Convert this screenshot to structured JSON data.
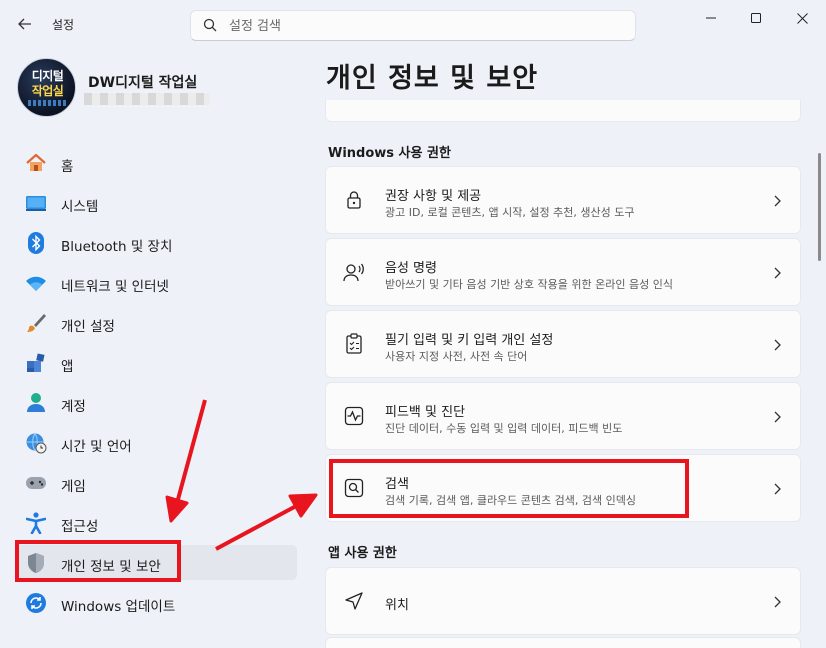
{
  "window": {
    "app_title": "설정",
    "search_placeholder": "설정 검색"
  },
  "profile": {
    "name": "DW디지털 작업실",
    "avatar_text_line1": "디지털",
    "avatar_text_line2": "작업실"
  },
  "sidebar": {
    "items": [
      {
        "label": "홈",
        "icon": "home-icon"
      },
      {
        "label": "시스템",
        "icon": "monitor-icon"
      },
      {
        "label": "Bluetooth 및 장치",
        "icon": "bluetooth-icon"
      },
      {
        "label": "네트워크 및 인터넷",
        "icon": "wifi-icon"
      },
      {
        "label": "개인 설정",
        "icon": "brush-icon"
      },
      {
        "label": "앱",
        "icon": "apps-icon"
      },
      {
        "label": "계정",
        "icon": "person-icon"
      },
      {
        "label": "시간 및 언어",
        "icon": "globe-clock-icon"
      },
      {
        "label": "게임",
        "icon": "gamepad-icon"
      },
      {
        "label": "접근성",
        "icon": "accessibility-icon"
      },
      {
        "label": "개인 정보 및 보안",
        "icon": "shield-icon",
        "selected": true
      },
      {
        "label": "Windows 업데이트",
        "icon": "update-icon"
      }
    ]
  },
  "main": {
    "page_title": "개인 정보 및 보안",
    "sections": [
      {
        "header": "Windows 사용 권한",
        "items": [
          {
            "title": "권장 사항 및 제공",
            "desc": "광고 ID, 로컬 콘텐츠, 앱 시작, 설정 추천, 생산성 도구",
            "icon": "lock-icon"
          },
          {
            "title": "음성 명령",
            "desc": "받아쓰기 및 기타 음성 기반 상호 작용을 위한 온라인 음성 인식",
            "icon": "voice-icon"
          },
          {
            "title": "필기 입력 및 키 입력 개인 설정",
            "desc": "사용자 지정 사전, 사전 속 단어",
            "icon": "clipboard-icon"
          },
          {
            "title": "피드백 및 진단",
            "desc": "진단 데이터, 수동 입력 및 입력 데이터, 피드백 빈도",
            "icon": "diagnostics-icon"
          },
          {
            "title": "검색",
            "desc": "검색 기록, 검색 앱, 클라우드 콘텐츠 검색, 검색 인덱싱",
            "icon": "search-box-icon"
          }
        ]
      },
      {
        "header": "앱 사용 권한",
        "items": [
          {
            "title": "위치",
            "desc": "",
            "icon": "location-icon"
          }
        ]
      }
    ]
  },
  "colors": {
    "background": "#eef2f8",
    "card": "#fbfbfc",
    "selected_nav": "#e3e6ed",
    "accent": "#0067c0",
    "annotation_red": "#e8141e"
  }
}
